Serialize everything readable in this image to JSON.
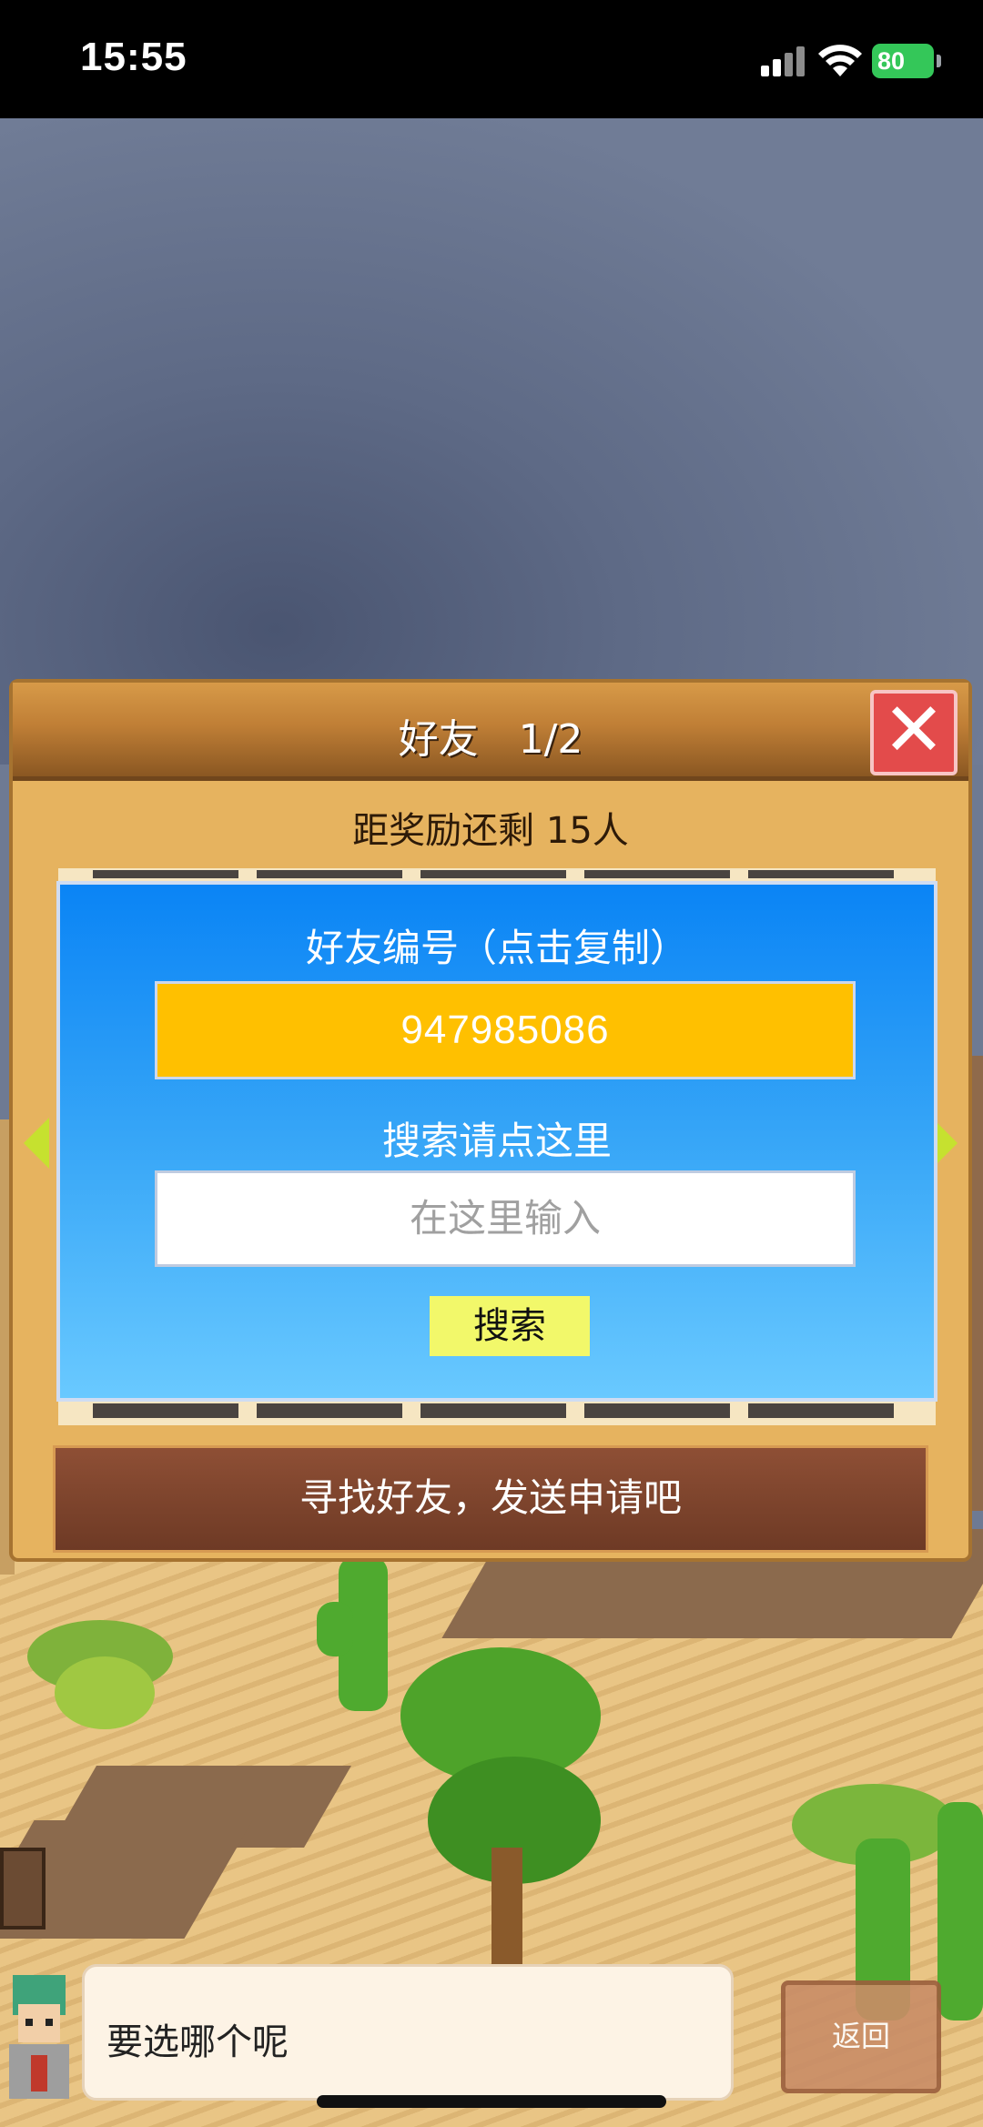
{
  "status_bar": {
    "time": "15:55",
    "battery": "80",
    "icons": [
      "signal-icon",
      "wifi-icon",
      "battery-charging-icon"
    ]
  },
  "dialog": {
    "title": "好友　1/2",
    "close_icon": "close-icon",
    "reward_text": "距奖励还剩 15人",
    "friend_id_label": "好友编号（点击复制）",
    "friend_id": "947985086",
    "search_label": "搜索请点这里",
    "search_placeholder": "在这里输入",
    "search_button": "搜索",
    "banner": "寻找好友，发送申请吧",
    "accent_colors": {
      "header": "#c07f36",
      "panel": "#2196f3",
      "id_box": "#ffc000",
      "close": "#e34b4b"
    }
  },
  "bottom_bar": {
    "speech": "要选哪个呢",
    "back_button": "返回"
  }
}
